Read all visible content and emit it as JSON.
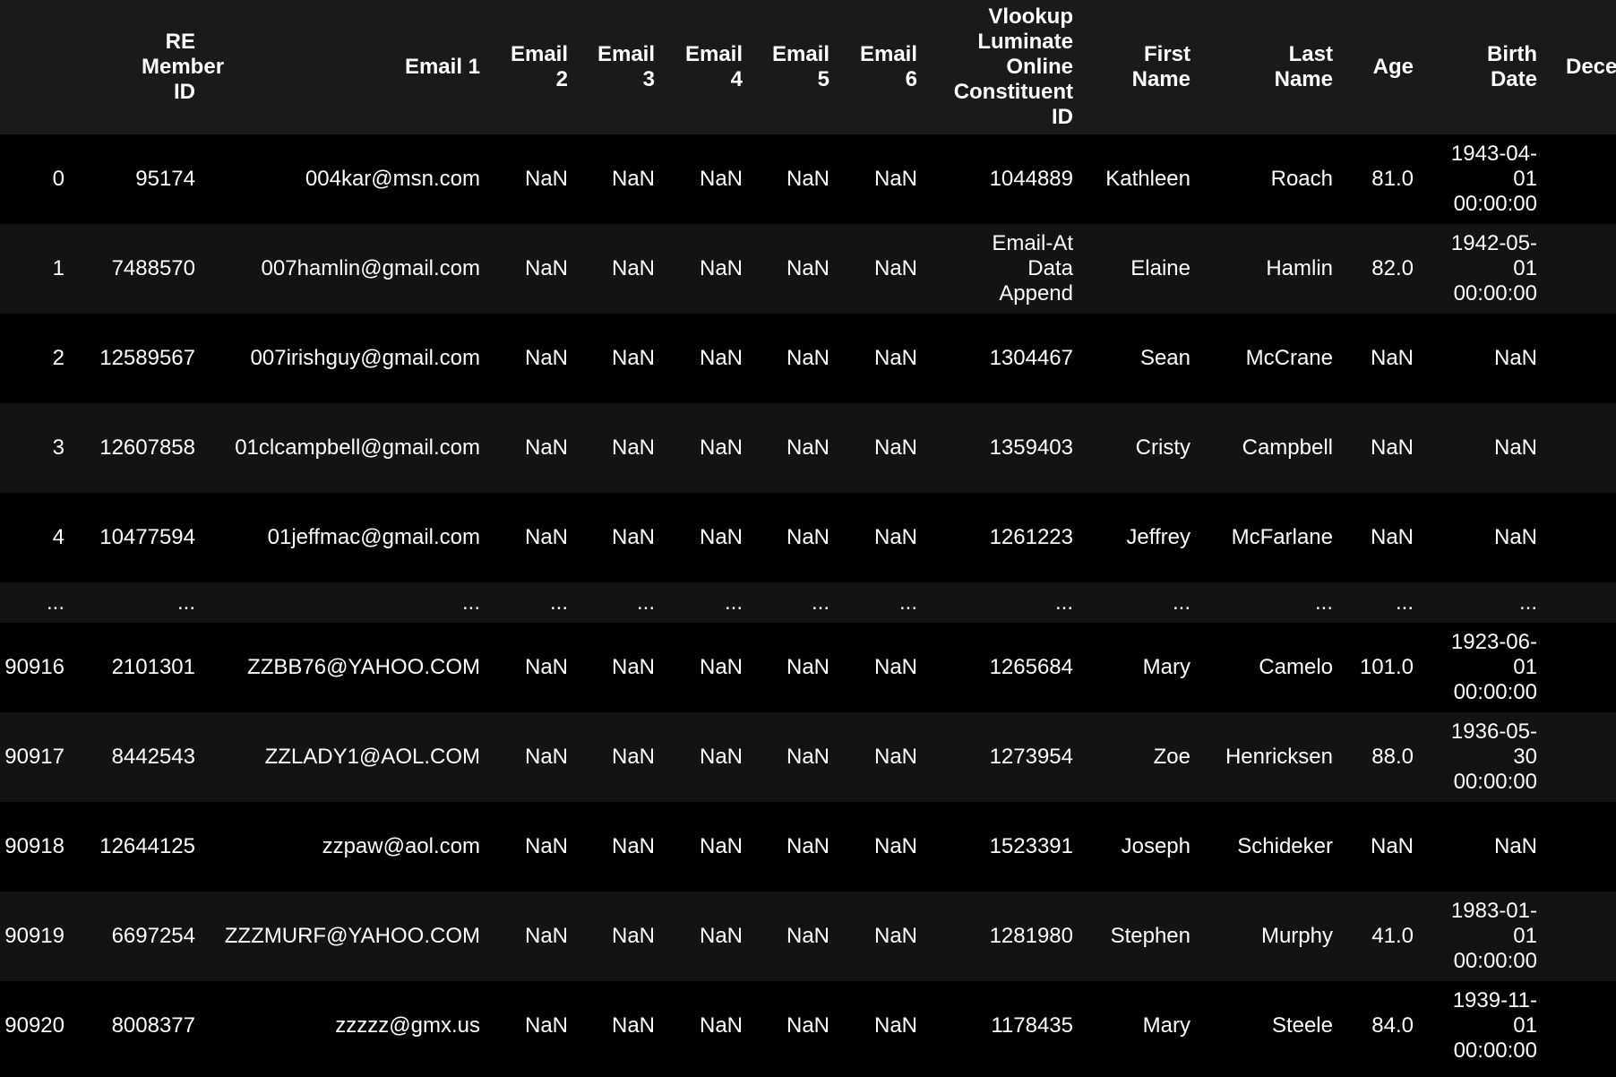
{
  "columns": [
    {
      "key": "index",
      "label": ""
    },
    {
      "key": "re_member_id",
      "label": "RE Member ID"
    },
    {
      "key": "email1",
      "label": "Email 1"
    },
    {
      "key": "email2",
      "label": "Email 2"
    },
    {
      "key": "email3",
      "label": "Email 3"
    },
    {
      "key": "email4",
      "label": "Email 4"
    },
    {
      "key": "email5",
      "label": "Email 5"
    },
    {
      "key": "email6",
      "label": "Email 6"
    },
    {
      "key": "vlookup",
      "label": "Vlookup Luminate Online Constituent ID"
    },
    {
      "key": "first",
      "label": "First Name"
    },
    {
      "key": "last",
      "label": "Last Name"
    },
    {
      "key": "age",
      "label": "Age"
    },
    {
      "key": "birth",
      "label": "Birth Date"
    },
    {
      "key": "dece",
      "label": "Dece"
    }
  ],
  "rows": [
    {
      "index": "0",
      "re_member_id": "95174",
      "email1": "004kar@msn.com",
      "email2": "NaN",
      "email3": "NaN",
      "email4": "NaN",
      "email5": "NaN",
      "email6": "NaN",
      "vlookup": "1044889",
      "first": "Kathleen",
      "last": "Roach",
      "age": "81.0",
      "birth": "1943-04-01 00:00:00",
      "dece": ""
    },
    {
      "index": "1",
      "re_member_id": "7488570",
      "email1": "007hamlin@gmail.com",
      "email2": "NaN",
      "email3": "NaN",
      "email4": "NaN",
      "email5": "NaN",
      "email6": "NaN",
      "vlookup": "Email-At Data Append",
      "first": "Elaine",
      "last": "Hamlin",
      "age": "82.0",
      "birth": "1942-05-01 00:00:00",
      "dece": ""
    },
    {
      "index": "2",
      "re_member_id": "12589567",
      "email1": "007irishguy@gmail.com",
      "email2": "NaN",
      "email3": "NaN",
      "email4": "NaN",
      "email5": "NaN",
      "email6": "NaN",
      "vlookup": "1304467",
      "first": "Sean",
      "last": "McCrane",
      "age": "NaN",
      "birth": "NaN",
      "dece": ""
    },
    {
      "index": "3",
      "re_member_id": "12607858",
      "email1": "01clcampbell@gmail.com",
      "email2": "NaN",
      "email3": "NaN",
      "email4": "NaN",
      "email5": "NaN",
      "email6": "NaN",
      "vlookup": "1359403",
      "first": "Cristy",
      "last": "Campbell",
      "age": "NaN",
      "birth": "NaN",
      "dece": ""
    },
    {
      "index": "4",
      "re_member_id": "10477594",
      "email1": "01jeffmac@gmail.com",
      "email2": "NaN",
      "email3": "NaN",
      "email4": "NaN",
      "email5": "NaN",
      "email6": "NaN",
      "vlookup": "1261223",
      "first": "Jeffrey",
      "last": "McFarlane",
      "age": "NaN",
      "birth": "NaN",
      "dece": ""
    },
    {
      "index": "...",
      "re_member_id": "...",
      "email1": "...",
      "email2": "...",
      "email3": "...",
      "email4": "...",
      "email5": "...",
      "email6": "...",
      "vlookup": "...",
      "first": "...",
      "last": "...",
      "age": "...",
      "birth": "...",
      "dece": ""
    },
    {
      "index": "90916",
      "re_member_id": "2101301",
      "email1": "ZZBB76@YAHOO.COM",
      "email2": "NaN",
      "email3": "NaN",
      "email4": "NaN",
      "email5": "NaN",
      "email6": "NaN",
      "vlookup": "1265684",
      "first": "Mary",
      "last": "Camelo",
      "age": "101.0",
      "birth": "1923-06-01 00:00:00",
      "dece": ""
    },
    {
      "index": "90917",
      "re_member_id": "8442543",
      "email1": "ZZLADY1@AOL.COM",
      "email2": "NaN",
      "email3": "NaN",
      "email4": "NaN",
      "email5": "NaN",
      "email6": "NaN",
      "vlookup": "1273954",
      "first": "Zoe",
      "last": "Henricksen",
      "age": "88.0",
      "birth": "1936-05-30 00:00:00",
      "dece": ""
    },
    {
      "index": "90918",
      "re_member_id": "12644125",
      "email1": "zzpaw@aol.com",
      "email2": "NaN",
      "email3": "NaN",
      "email4": "NaN",
      "email5": "NaN",
      "email6": "NaN",
      "vlookup": "1523391",
      "first": "Joseph",
      "last": "Schideker",
      "age": "NaN",
      "birth": "NaN",
      "dece": ""
    },
    {
      "index": "90919",
      "re_member_id": "6697254",
      "email1": "ZZZMURF@YAHOO.COM",
      "email2": "NaN",
      "email3": "NaN",
      "email4": "NaN",
      "email5": "NaN",
      "email6": "NaN",
      "vlookup": "1281980",
      "first": "Stephen",
      "last": "Murphy",
      "age": "41.0",
      "birth": "1983-01-01 00:00:00",
      "dece": ""
    },
    {
      "index": "90920",
      "re_member_id": "8008377",
      "email1": "zzzzz@gmx.us",
      "email2": "NaN",
      "email3": "NaN",
      "email4": "NaN",
      "email5": "NaN",
      "email6": "NaN",
      "vlookup": "1178435",
      "first": "Mary",
      "last": "Steele",
      "age": "84.0",
      "birth": "1939-11-01 00:00:00",
      "dece": ""
    }
  ]
}
